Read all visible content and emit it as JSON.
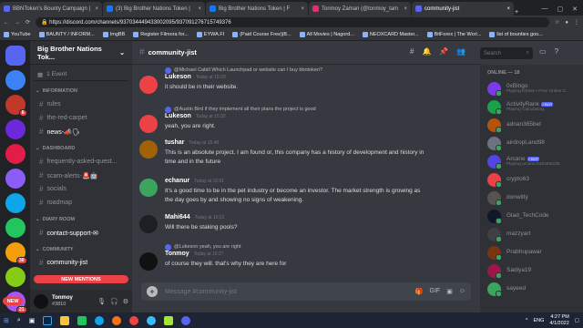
{
  "browser": {
    "tabs": [
      {
        "title": "BBNToken's Bounty Campaign |",
        "color": "#5865f2",
        "active": false
      },
      {
        "title": "(3) Big Brother Nations Token |",
        "color": "#1877f2",
        "active": false
      },
      {
        "title": "Big Brother Nations Token | F",
        "color": "#1877f2",
        "active": false
      },
      {
        "title": "Tonmoy Zaman (@tonmoy_tam",
        "color": "#e1306c",
        "active": false
      },
      {
        "title": "community-jist",
        "color": "#5865f2",
        "active": true
      }
    ],
    "url": "https://discord.com/channels/937034449433002095/937091276715749376",
    "bookmarks": [
      "YouTube",
      "BAUNTY / INFORM...",
      "ImgBB",
      "Register Filmora for...",
      "EYWA.FI",
      "(Paid Course Free)|B...",
      "All Movies | Nagord...",
      "NEOXCARD Master...",
      "BitForex | The Worl...",
      "list of bounties goo..."
    ]
  },
  "servers": [
    {
      "letter": "",
      "color": "#5865f2",
      "badge": ""
    },
    {
      "letter": "",
      "color": "#3b82f6",
      "badge": ""
    },
    {
      "letter": "",
      "color": "#c0392b",
      "badge": "6"
    },
    {
      "letter": "",
      "color": "#6d28d9",
      "badge": ""
    },
    {
      "letter": "",
      "color": "#e11d48",
      "badge": ""
    },
    {
      "letter": "",
      "color": "#8b5cf6",
      "badge": ""
    },
    {
      "letter": "",
      "color": "#0ea5e9",
      "badge": ""
    },
    {
      "letter": "",
      "color": "#22c55e",
      "badge": ""
    },
    {
      "letter": "",
      "color": "#f59e0b",
      "badge": "30"
    },
    {
      "letter": "",
      "color": "#84cc16",
      "badge": ""
    },
    {
      "letter": "",
      "color": "#a855f7",
      "badge": "21"
    },
    {
      "letter": "",
      "color": "#f97316",
      "badge": ""
    }
  ],
  "sidebar": {
    "guild_name": "Big Brother Nations Tok...",
    "events": "1 Event",
    "categories": [
      {
        "name": "INFORMATION",
        "channels": [
          {
            "name": "rules",
            "bright": false
          },
          {
            "name": "the-red-carpet",
            "bright": false
          },
          {
            "name": "news-📣🗣",
            "bright": true
          }
        ]
      },
      {
        "name": "DASHBOARD",
        "channels": [
          {
            "name": "frequently-asked-quest...",
            "bright": false
          },
          {
            "name": "scam-alerts-🚨🤖",
            "bright": false
          },
          {
            "name": "socials",
            "bright": false
          },
          {
            "name": "roadmap",
            "bright": false
          }
        ]
      },
      {
        "name": "DIARY ROOM",
        "channels": [
          {
            "name": "contact-support-✉",
            "bright": true
          }
        ]
      },
      {
        "name": "COMMUNITY",
        "channels": [
          {
            "name": "community-jist",
            "bright": true
          }
        ]
      }
    ],
    "new_mentions": "NEW MENTIONS",
    "user": {
      "name": "Tonmoy",
      "tag": "#3810"
    }
  },
  "chat": {
    "channel": "community-jist",
    "search_placeholder": "Search",
    "composer_placeholder": "Message #community-jist",
    "messages": [
      {
        "reply": "@Michael Cabill Which Launchpad or website can I buy bbntoken?",
        "author": "Lukeson",
        "time": "Today at 15:29",
        "text": [
          "it should be in their website."
        ],
        "color": "#ed4245"
      },
      {
        "reply": "@Austin Bird if they implement all their plans the project is good",
        "author": "Lukeson",
        "time": "Today at 15:32",
        "text": [
          "yeah, you are right."
        ],
        "color": "#ed4245"
      },
      {
        "reply": "",
        "author": "tushar",
        "time": "Today at 15:48",
        "text": [
          "This is an absolute project. I am found or, this company has a history of development and history in",
          "time and in the future"
        ],
        "color": "#a16207"
      },
      {
        "reply": "",
        "author": "echanur",
        "time": "Today at 15:51",
        "text": [
          "It's a good time to be in the pet industry or become an investor. The market strength is growing as",
          "the day goes by and showing no signs of weakening."
        ],
        "color": "#3ba55d"
      },
      {
        "reply": "",
        "author": "Mahi644",
        "time": "Today at 16:21",
        "text": [
          "Will there be staking pools?"
        ],
        "color": "#1e1f22"
      },
      {
        "reply": "@Lukeson yeah, you are right",
        "author": "Tonmoy",
        "time": "Today at 16:27",
        "text": [
          "of course they will. that's why they are here for"
        ],
        "color": "#111111"
      }
    ]
  },
  "members": {
    "header": "ONLINE — 18",
    "list": [
      {
        "name": "0xBingo",
        "status": "Playing Ichess • Free Online C...",
        "bot": false,
        "color": "#7c3aed"
      },
      {
        "name": "ActivityRank",
        "status": "Playing Calculating...",
        "bot": true,
        "color": "#16a34a"
      },
      {
        "name": "adnan365bet",
        "status": "",
        "bot": false,
        "color": "#b45309"
      },
      {
        "name": "airdropLand98",
        "status": "",
        "bot": false,
        "color": "#6b7280"
      },
      {
        "name": "Arcane",
        "status": "Playing arcane.bot/183/236",
        "bot": true,
        "color": "#4f46e5"
      },
      {
        "name": "crypto63",
        "status": "",
        "bot": false,
        "color": "#ed4245"
      },
      {
        "name": "donwitty",
        "status": "",
        "bot": false,
        "color": "#57534e"
      },
      {
        "name": "Glad_TechCode",
        "status": "",
        "bot": false,
        "color": "#0f172a"
      },
      {
        "name": "mazzyart",
        "status": "",
        "bot": false,
        "color": "#3f3f46"
      },
      {
        "name": "Prabhupawar",
        "status": "",
        "bot": false,
        "color": "#78350f"
      },
      {
        "name": "Sadiya19",
        "status": "",
        "bot": false,
        "color": "#9d174d"
      },
      {
        "name": "sayeed",
        "status": "",
        "bot": false,
        "color": "#3ba55d"
      }
    ]
  },
  "taskbar": {
    "time": "4:27 PM",
    "date": "4/1/2022",
    "lang": "ENG"
  },
  "new_pill": "NEW"
}
